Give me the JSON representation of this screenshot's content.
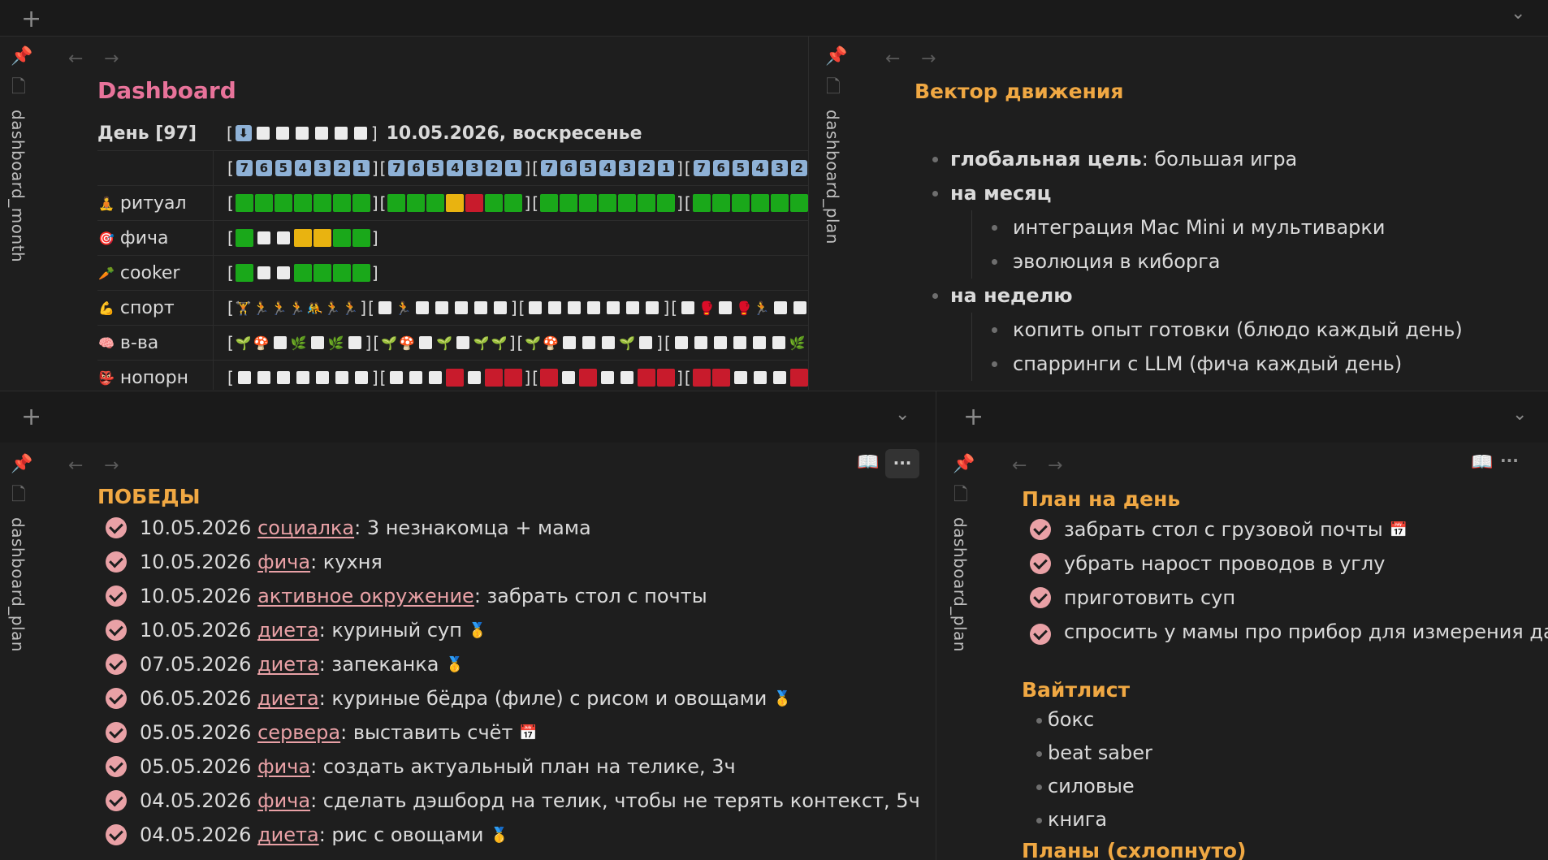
{
  "colors": {
    "accent_pink": "#e8739a",
    "accent_orange": "#f0a843",
    "check": "#e9a1a6",
    "green": "#1aa81a",
    "yellow": "#e9b310",
    "red": "#c81b2c"
  },
  "panes": {
    "top_left_vtitle": "dashboard_month",
    "top_right_vtitle": "dashboard_plan",
    "bottom_left_vtitle": "dashboard_plan",
    "bottom_right_vtitle": "dashboard_plan"
  },
  "dashboard": {
    "title": "Dashboard",
    "day_label": "День [97]",
    "date_text": "10.05.2026, воскресенье",
    "countdown": [
      "7",
      "6",
      "5",
      "4",
      "3",
      "2",
      "1"
    ],
    "rows": [
      {
        "icon": "🧘",
        "label": "ритуал"
      },
      {
        "icon": "🎯",
        "label": "фича"
      },
      {
        "icon": "🥕",
        "label": "cooker"
      },
      {
        "icon": "💪",
        "label": "спорт"
      },
      {
        "icon": "🧠",
        "label": "в-ва"
      },
      {
        "icon": "👺",
        "label": "нопорн"
      }
    ]
  },
  "vector": {
    "title": "Вектор движения",
    "items": [
      {
        "bold": "глобальная цель",
        "rest": ": большая игра"
      },
      {
        "bold": "на месяц",
        "rest": ""
      },
      {
        "sub": "интеграция Mac Mini и мультиварки"
      },
      {
        "sub": "эволюция в киборга"
      },
      {
        "bold": "на неделю",
        "rest": ""
      },
      {
        "sub": "копить опыт готовки (блюдо каждый день)"
      },
      {
        "sub": "спарринги с LLM (фича каждый день)"
      }
    ]
  },
  "wins": {
    "title": "ПОБЕДЫ",
    "items": [
      {
        "date": "10.05.2026",
        "tag": "социалка",
        "text": ": 3 незнакомца + мама",
        "medal": ""
      },
      {
        "date": "10.05.2026",
        "tag": "фича",
        "text": ": кухня",
        "medal": ""
      },
      {
        "date": "10.05.2026",
        "tag": "активное окружение",
        "text": ": забрать стол с почты",
        "medal": ""
      },
      {
        "date": "10.05.2026",
        "tag": "диета",
        "text": ": куриный суп",
        "medal": "🥇"
      },
      {
        "date": "07.05.2026",
        "tag": "диета",
        "text": ": запеканка",
        "medal": "🥇"
      },
      {
        "date": "06.05.2026",
        "tag": "диета",
        "text": ": куриные бёдра (филе) с рисом и овощами",
        "medal": "🥇"
      },
      {
        "date": "05.05.2026",
        "tag": "сервера",
        "text": ": выставить счёт",
        "medal": "📅"
      },
      {
        "date": "05.05.2026",
        "tag": "фича",
        "text": ": создать актуальный план на телике, 3ч",
        "medal": ""
      },
      {
        "date": "04.05.2026",
        "tag": "фича",
        "text": ": сделать дэшборд на телик, чтобы не терять контекст, 5ч",
        "medal": ""
      },
      {
        "date": "04.05.2026",
        "tag": "диета",
        "text": ":  рис с овощами",
        "medal": "🥇"
      }
    ]
  },
  "dayplan": {
    "title": "План на день",
    "items": [
      "забрать стол с грузовой почты",
      "убрать нарост проводов в углу",
      "приготовить суп",
      "спросить у мамы про прибор для измерения давления"
    ],
    "calendar_emoji": "📅",
    "whitelist_title": "Вайтлист",
    "whitelist": [
      "бокс",
      "beat saber",
      "силовые",
      "книга"
    ],
    "collapsed_title": "Планы (схлопнуто)"
  },
  "icons": {
    "plus": "+",
    "chevron": "⌄",
    "back": "←",
    "forward": "→",
    "book": "📖",
    "more": "···"
  }
}
